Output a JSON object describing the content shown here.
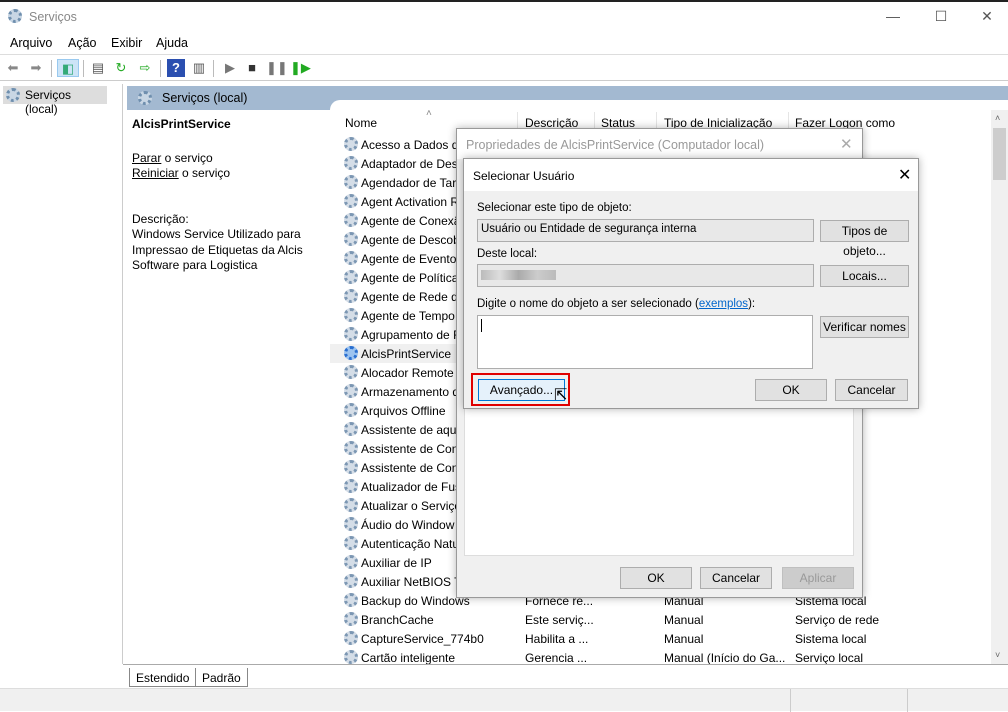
{
  "window": {
    "title": "Serviços",
    "controls": [
      "—",
      "☐",
      "✕"
    ]
  },
  "menu": [
    "Arquivo",
    "Ação",
    "Exibir",
    "Ajuda"
  ],
  "tree": {
    "selected": "Serviços (local)"
  },
  "panel": {
    "title": "Serviços (local)",
    "service_name": "AlcisPrintService",
    "stop_link": "Parar",
    "stop_suffix": " o serviço",
    "restart_link": "Reiniciar",
    "restart_suffix": " o serviço",
    "desc_label": "Descrição:",
    "desc_text": "Windows Service Utilizado para Impressao de Etiquetas da Alcis Software para Logistica"
  },
  "columns": [
    "Nome",
    "Descrição",
    "Status",
    "Tipo de Inicialização",
    "Fazer Logon como"
  ],
  "rows": [
    {
      "name": "Acesso a Dados de"
    },
    {
      "name": "Adaptador de Desc"
    },
    {
      "name": "Agendador de Tare"
    },
    {
      "name": "Agent Activation R"
    },
    {
      "name": "Agente de Conexã"
    },
    {
      "name": "Agente de Descob"
    },
    {
      "name": "Agente de Eventos"
    },
    {
      "name": "Agente de Política"
    },
    {
      "name": "Agente de Rede d"
    },
    {
      "name": "Agente de Tempo"
    },
    {
      "name": "Agrupamento de F"
    },
    {
      "name": "AlcisPrintService",
      "selected": true
    },
    {
      "name": "Alocador Remote"
    },
    {
      "name": "Armazenamento d"
    },
    {
      "name": "Arquivos Offline"
    },
    {
      "name": "Assistente de aqui"
    },
    {
      "name": "Assistente de Con"
    },
    {
      "name": "Assistente de Con"
    },
    {
      "name": "Atualizador de Fus"
    },
    {
      "name": "Atualizar o Serviço"
    },
    {
      "name": "Áudio do Window"
    },
    {
      "name": "Autenticação Natu"
    },
    {
      "name": "Auxiliar de IP"
    },
    {
      "name": "Auxiliar NetBIOS T"
    },
    {
      "name": "Backup do Windows",
      "desc": "Fornece re...",
      "status": "",
      "startup": "Manual",
      "logon": "Sistema local"
    },
    {
      "name": "BranchCache",
      "desc": "Este serviç...",
      "status": "",
      "startup": "Manual",
      "logon": "Serviço de rede"
    },
    {
      "name": "CaptureService_774b0",
      "desc": "Habilita a ...",
      "status": "",
      "startup": "Manual",
      "logon": "Sistema local"
    },
    {
      "name": "Cartão inteligente",
      "desc": "Gerencia ...",
      "status": "",
      "startup": "Manual (Início do Ga...",
      "logon": "Serviço local"
    }
  ],
  "tabs": [
    "Estendido",
    "Padrão"
  ],
  "props": {
    "title": "Propriedades de AlcisPrintService (Computador local)",
    "ok": "OK",
    "cancel": "Cancelar",
    "apply": "Aplicar"
  },
  "select_user": {
    "title": "Selecionar Usuário",
    "type_label": "Selecionar este tipo de objeto:",
    "type_value": "Usuário ou Entidade de segurança interna",
    "types_button": "Tipos de objeto...",
    "location_label": "Deste local:",
    "locations_button": "Locais...",
    "name_label": "Digite o nome do objeto a ser selecionado (",
    "examples_link": "exemplos",
    "name_label_end": "):",
    "name_value": "",
    "check_button": "Verificar nomes",
    "advanced_button": "Avançado...",
    "ok": "OK",
    "cancel": "Cancelar"
  },
  "colors": {
    "highlight": "#e00000",
    "header": "#a3b9d1",
    "link": "#0066cc"
  }
}
